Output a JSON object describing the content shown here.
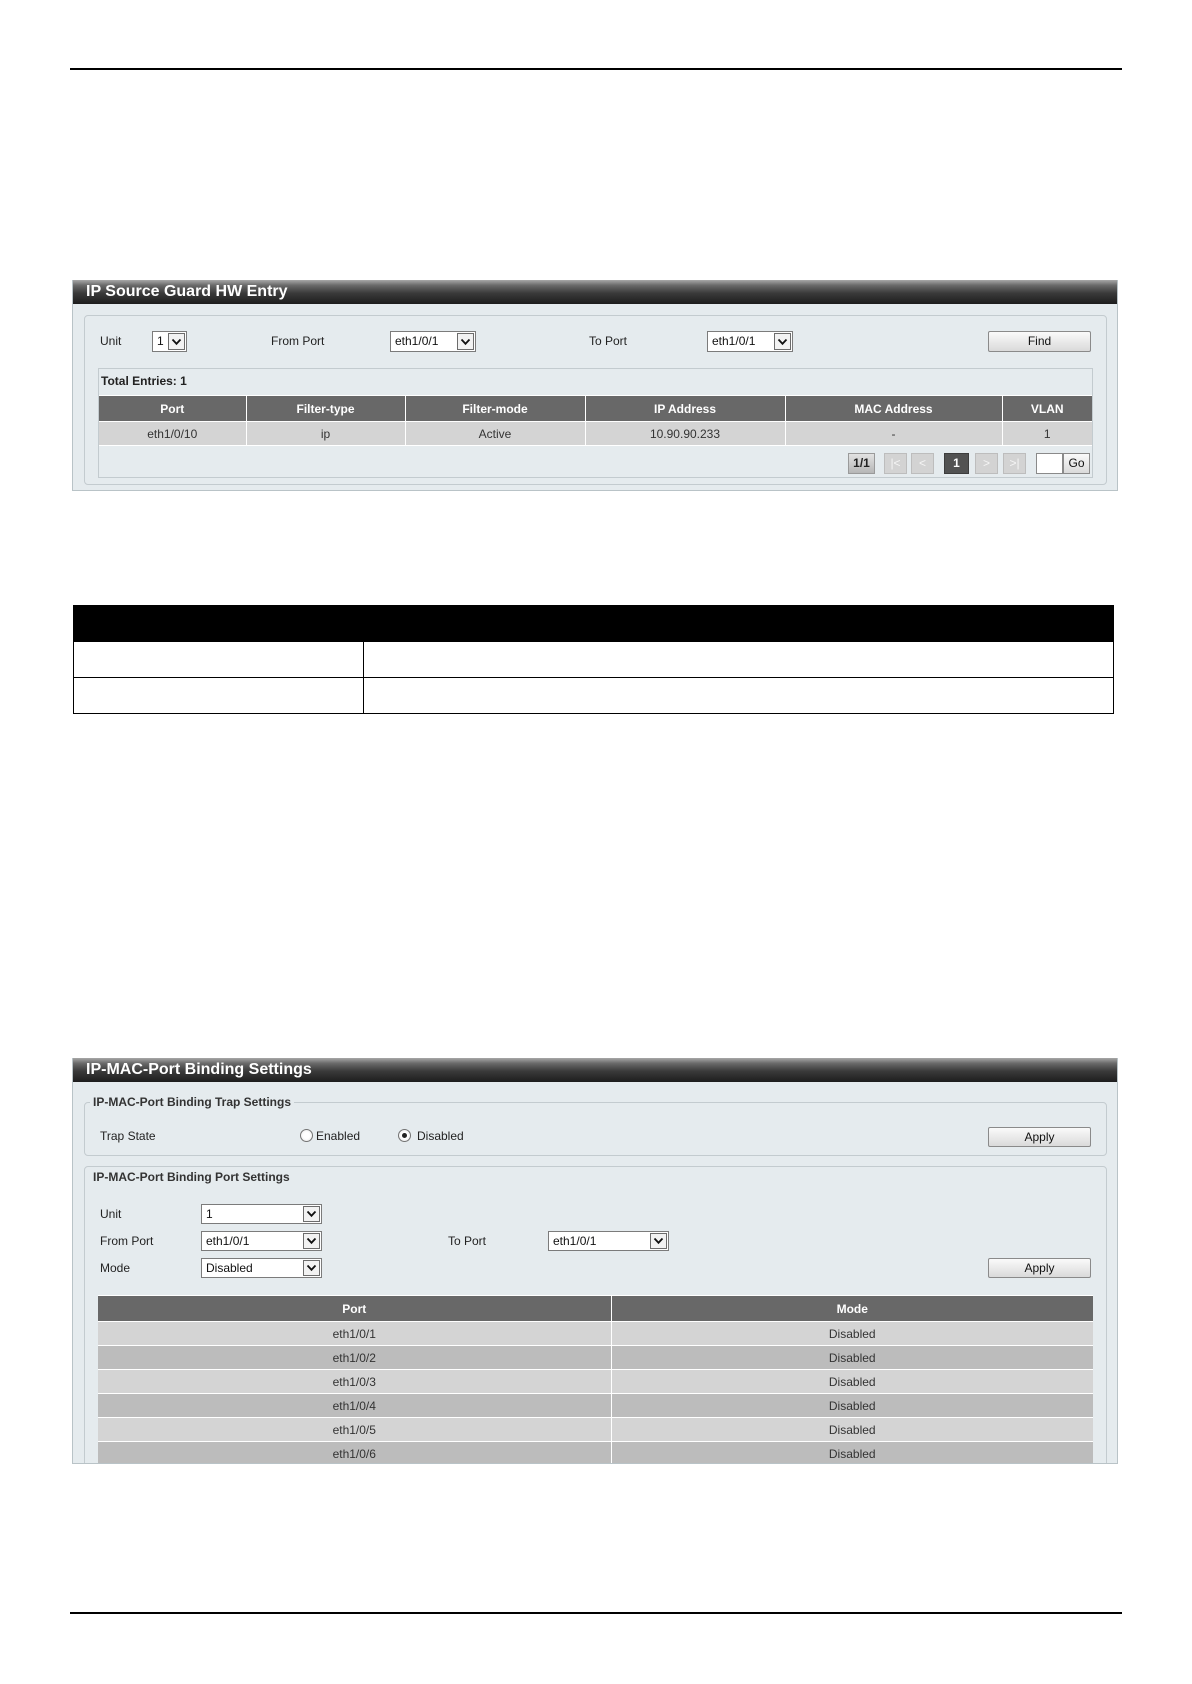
{
  "theme": {
    "panel_header": "#1d1d1d",
    "panel_background": "#e5ebee",
    "table_header": "#686868",
    "row_light": "#d4d4d4",
    "row_dark": "#bcbcbc",
    "current_page": "#525252",
    "doc_table_header": "#000000"
  },
  "source_guard": {
    "title": "IP Source Guard HW Entry",
    "unit": {
      "label": "Unit",
      "value": "1"
    },
    "from_port": {
      "label": "From Port",
      "value": "eth1/0/1"
    },
    "to_port": {
      "label": "To Port",
      "value": "eth1/0/1"
    },
    "find_button": "Find",
    "total_entries": "Total Entries: 1",
    "columns": [
      "Port",
      "Filter-type",
      "Filter-mode",
      "IP Address",
      "MAC Address",
      "VLAN"
    ],
    "rows": [
      {
        "port": "eth1/0/10",
        "filter_type": "ip",
        "filter_mode": "Active",
        "ip_address": "10.90.90.233",
        "mac_address": "-",
        "vlan": "1"
      }
    ],
    "pagination": {
      "page_info": "1/1",
      "first": "|<",
      "prev": "<",
      "current_page": "1",
      "next": ">",
      "last": ">|",
      "go_button": "Go"
    }
  },
  "binding": {
    "title": "IP-MAC-Port Binding Settings",
    "trap_settings": {
      "legend": "IP-MAC-Port Binding Trap Settings",
      "trap_state_label": "Trap State",
      "options": [
        "Enabled",
        "Disabled"
      ],
      "selected": "Disabled",
      "apply_button": "Apply"
    },
    "port_settings": {
      "legend": "IP-MAC-Port Binding Port Settings",
      "unit": {
        "label": "Unit",
        "value": "1"
      },
      "from_port": {
        "label": "From Port",
        "value": "eth1/0/1"
      },
      "to_port": {
        "label": "To Port",
        "value": "eth1/0/1"
      },
      "mode": {
        "label": "Mode",
        "value": "Disabled"
      },
      "apply_button": "Apply",
      "columns": [
        "Port",
        "Mode"
      ],
      "rows": [
        {
          "port": "eth1/0/1",
          "mode": "Disabled"
        },
        {
          "port": "eth1/0/2",
          "mode": "Disabled"
        },
        {
          "port": "eth1/0/3",
          "mode": "Disabled"
        },
        {
          "port": "eth1/0/4",
          "mode": "Disabled"
        },
        {
          "port": "eth1/0/5",
          "mode": "Disabled"
        },
        {
          "port": "eth1/0/6",
          "mode": "Disabled"
        }
      ]
    }
  }
}
